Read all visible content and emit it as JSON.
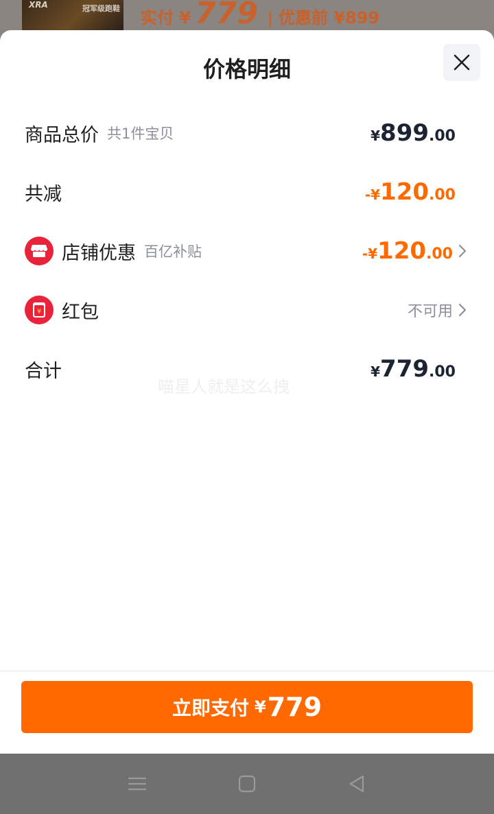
{
  "background": {
    "thumb_brand": "XRA",
    "thumb_caption": "冠军级跑鞋",
    "price_prefix": "实付 ¥",
    "price_value": "779",
    "price_sep": "|",
    "original_price": "优惠前 ¥899"
  },
  "sheet": {
    "title": "价格明细",
    "close_icon": "close-icon"
  },
  "rows": {
    "goods_total": {
      "label": "商品总价",
      "sub": "共1件宝贝",
      "currency": "¥",
      "int": "899",
      "dec": ".00"
    },
    "total_discount": {
      "label": "共减",
      "currency": "-¥",
      "int": "120",
      "dec": ".00"
    },
    "store_discount": {
      "label": "店铺优惠",
      "sub": "百亿补贴",
      "currency": "-¥",
      "int": "120",
      "dec": ".00",
      "icon": "store-icon"
    },
    "red_packet": {
      "label": "红包",
      "status": "不可用",
      "icon": "red-packet-icon",
      "icon_glyph": "¥"
    },
    "sum": {
      "label": "合计",
      "currency": "¥",
      "int": "779",
      "dec": ".00"
    }
  },
  "watermark": "喵星人就是这么拽",
  "pay_button": {
    "label": "立即支付",
    "currency": "¥",
    "value": "779"
  },
  "navbar": {
    "menu_icon": "menu-icon",
    "home_icon": "home-icon",
    "back_icon": "back-icon"
  },
  "colors": {
    "accent": "#ff6900",
    "discount": "#ff6a00",
    "icon_red": "#e8233a",
    "text_dark": "#1c2433",
    "text_muted": "#8a8f99"
  }
}
